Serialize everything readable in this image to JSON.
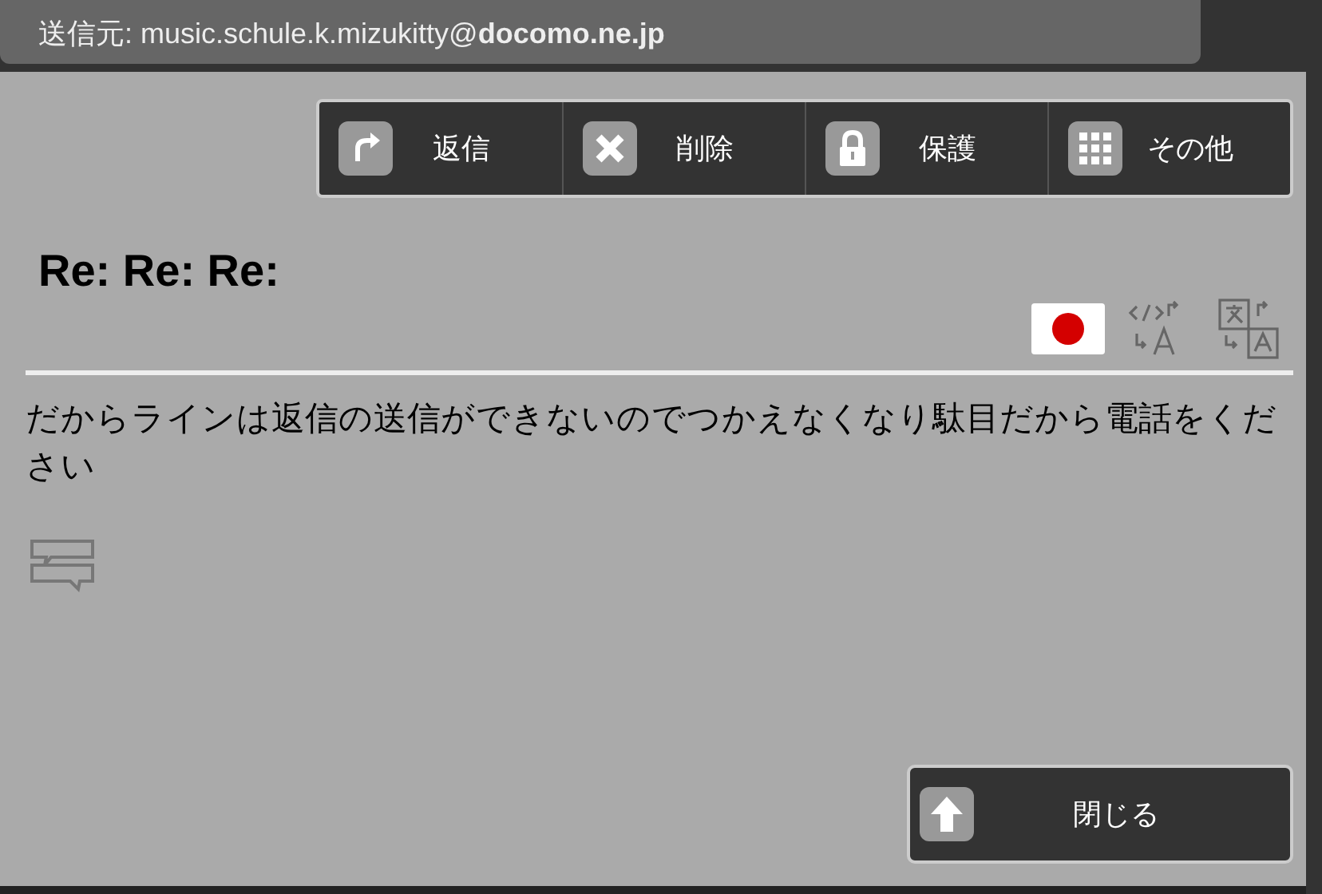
{
  "header": {
    "sender": "送信元: music.schule.k.mizukitty@**docomo.ne.jp**"
  },
  "toolbar": [
    {
      "kind": "reply",
      "label": "返信"
    },
    {
      "kind": "delete",
      "label": "削除"
    },
    {
      "kind": "protect",
      "label": "保護"
    },
    {
      "kind": "more",
      "label": "その他"
    }
  ],
  "subject": "Re: Re: Re:",
  "body": "だからラインは返信の送信ができないのでつかえなくなり駄目だから電話をください",
  "close_button": {
    "label": "閉じる"
  }
}
